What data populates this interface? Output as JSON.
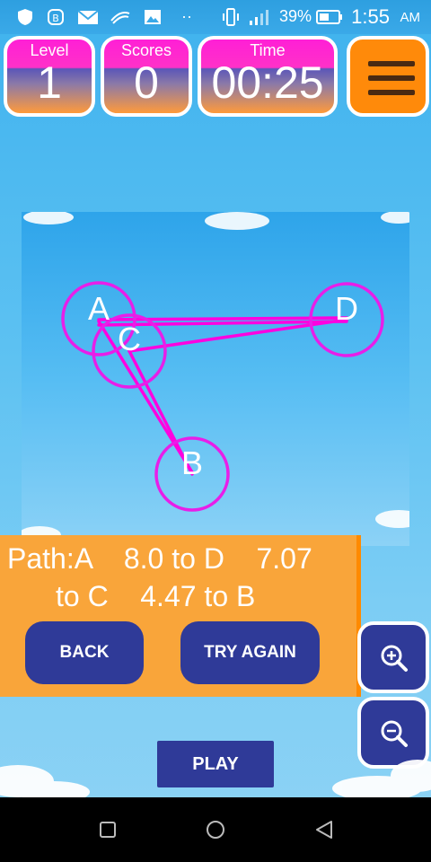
{
  "status_bar": {
    "battery_percent": "39%",
    "time": "1:55",
    "ampm": "AM",
    "icons": [
      "shield-icon",
      "b-app-icon",
      "gmail-icon",
      "swiftkey-icon",
      "gallery-icon",
      "more-dots-icon",
      "vibrate-icon",
      "signal-icon",
      "battery-icon"
    ]
  },
  "hud": {
    "level_label": "Level",
    "level_value": "1",
    "scores_label": "Scores",
    "scores_value": "0",
    "time_label": "Time",
    "time_value": "00:25",
    "menu_icon": "hamburger-menu-icon"
  },
  "board": {
    "nodes": [
      {
        "id": "A",
        "label": "A"
      },
      {
        "id": "B",
        "label": "B"
      },
      {
        "id": "C",
        "label": "C"
      },
      {
        "id": "D",
        "label": "D"
      }
    ],
    "path_color": "#ff00e0"
  },
  "path_panel": {
    "line1": "Path:A    8.0 to D    7.07",
    "line2": "to C    4.47 to B",
    "back_label": "BACK",
    "try_again_label": "TRY AGAIN"
  },
  "zoom": {
    "in_icon": "zoom-in-icon",
    "out_icon": "zoom-out-icon"
  },
  "play_label": "PLAY",
  "nav_bar": {
    "icons": [
      "recent-apps-icon",
      "home-icon",
      "back-icon"
    ]
  }
}
